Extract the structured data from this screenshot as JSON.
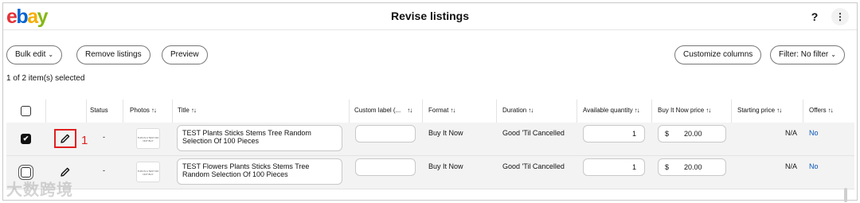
{
  "app": {
    "logo": {
      "e": "e",
      "b": "b",
      "a": "a",
      "y": "y"
    },
    "title": "Revise listings",
    "help_label": "?",
    "more_label": "⋮"
  },
  "toolbar": {
    "bulk_edit": "Bulk edit",
    "remove_listings": "Remove listings",
    "preview": "Preview",
    "customize_columns": "Customize columns",
    "filter": "Filter: No filter",
    "chevron": "⌄"
  },
  "selection_text": "1 of 2 item(s) selected",
  "columns": {
    "status": "Status",
    "photos": "Photos",
    "title": "Title",
    "custom_label": "Custom label (...",
    "format": "Format",
    "duration": "Duration",
    "available_quantity": "Available quantity",
    "buy_it_now_price": "Buy It Now price",
    "starting_price": "Starting price",
    "offers": "Offers",
    "sort_icon": "↑↓"
  },
  "rows": [
    {
      "checked": true,
      "status": "-",
      "photo_text": "THIS IS A TEST DO NOT BUY",
      "title": "TEST Plants Sticks Stems Tree Random Selection Of 100 Pieces",
      "custom_label": "",
      "format": "Buy It Now",
      "duration": "Good 'Til Cancelled",
      "quantity": "1",
      "currency": "$",
      "price": "20.00",
      "starting_price": "N/A",
      "offers": "No"
    },
    {
      "checked": false,
      "status": "-",
      "photo_text": "THIS IS A TEST DO NOT BUY",
      "title": "TEST Flowers Plants Sticks Stems Tree Random Selection Of 100 Pieces",
      "custom_label": "",
      "format": "Buy It Now",
      "duration": "Good 'Til Cancelled",
      "quantity": "1",
      "currency": "$",
      "price": "20.00",
      "starting_price": "N/A",
      "offers": "No"
    }
  ],
  "annotation": {
    "step": "1"
  },
  "watermark": "大数跨境",
  "icons": {
    "edit": "pencil-icon",
    "check": "✔"
  },
  "colors": {
    "highlight": "#e02020",
    "link": "#0654ba"
  }
}
